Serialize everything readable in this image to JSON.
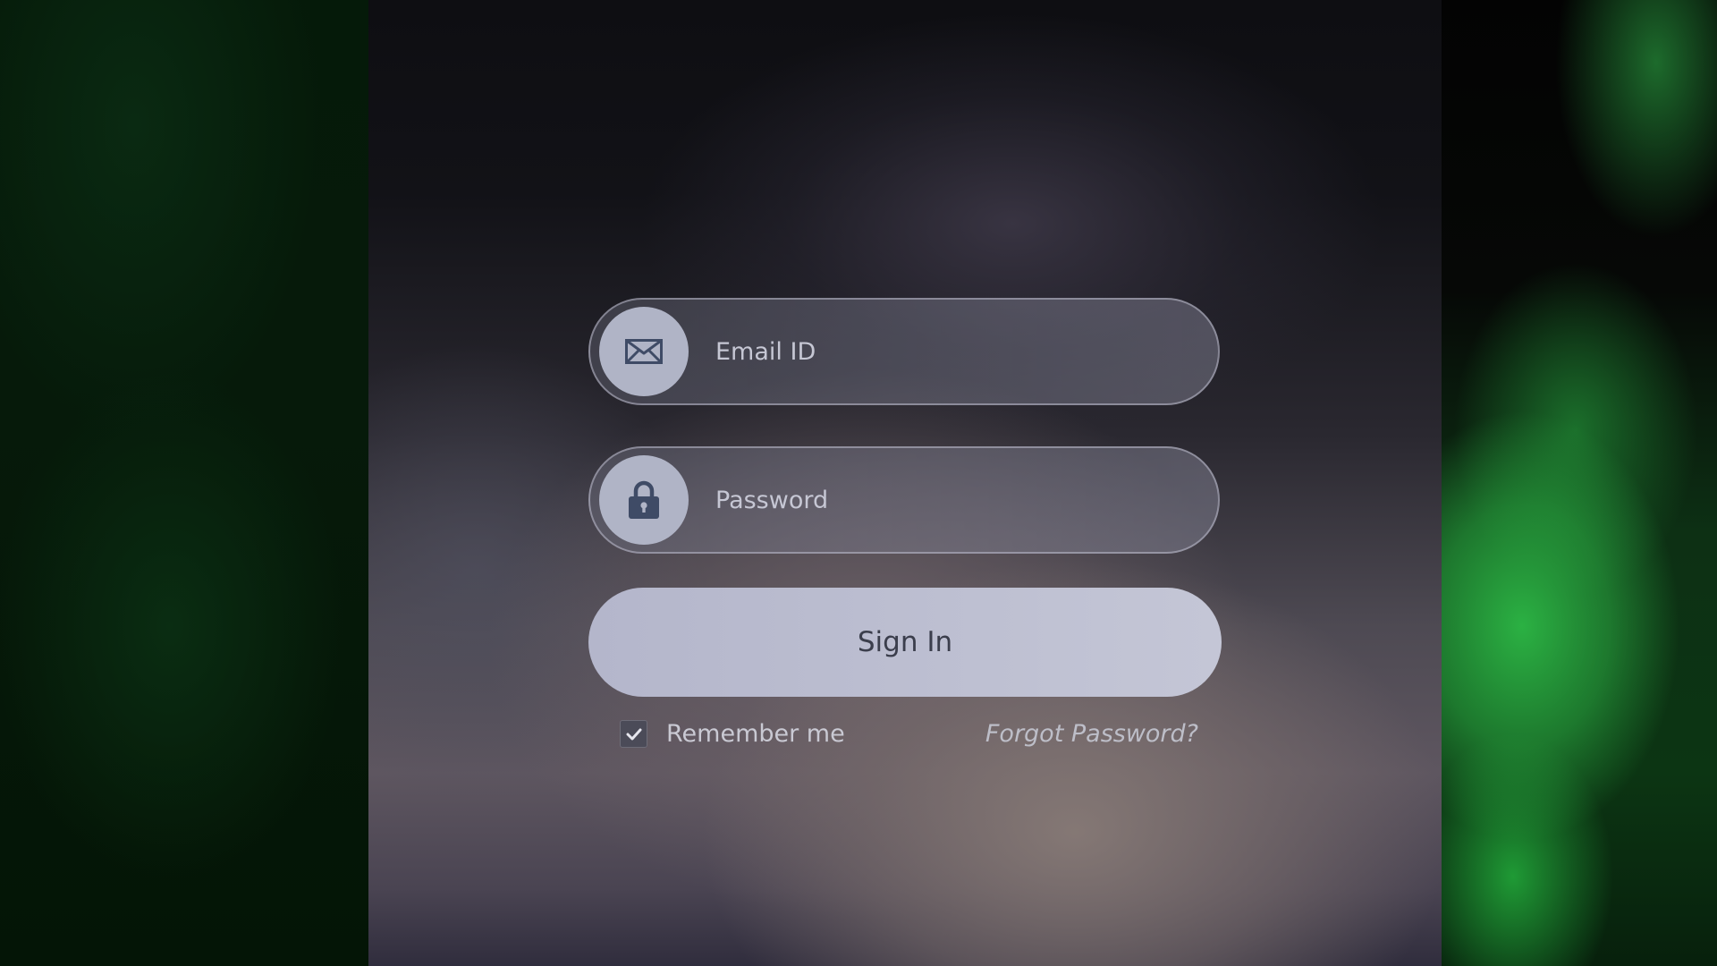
{
  "login_form": {
    "email_placeholder": "Email ID",
    "password_placeholder": "Password",
    "signin_label": "Sign In",
    "remember_label": "Remember me",
    "remember_checked": true,
    "forgot_label": "Forgot Password?"
  },
  "icons": {
    "email": "envelope-icon",
    "password": "lock-icon",
    "checkbox": "checkmark-icon"
  },
  "colors": {
    "icon_circle": "#b0b4c6",
    "icon_glyph": "#3f4b66",
    "button_fill": "#c0c2d3",
    "button_text": "#3b3e4c",
    "side_green": "#2bb143"
  }
}
